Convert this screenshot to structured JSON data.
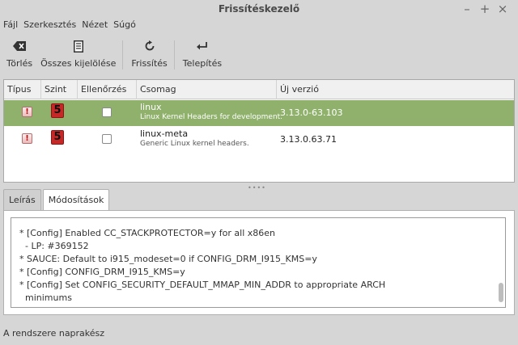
{
  "window": {
    "title": "Frissítéskezelő"
  },
  "menu": [
    "Fájl",
    "Szerkesztés",
    "Nézet",
    "Súgó"
  ],
  "toolbar": {
    "clear_label": "Törlés",
    "select_all_label": "Összes kijelölése",
    "refresh_label": "Frissítés",
    "install_label": "Telepítés"
  },
  "table": {
    "headers": [
      "Típus",
      "Szint",
      "Ellenőrzés",
      "Csomag",
      "Új verzió"
    ],
    "rows": [
      {
        "level": "5",
        "name": "linux",
        "description": "Linux Kernel Headers for development.",
        "version": "3.13.0-63.103",
        "selected": true
      },
      {
        "level": "5",
        "name": "linux-meta",
        "description": "Generic Linux kernel headers.",
        "version": "3.13.0.63.71",
        "selected": false
      }
    ]
  },
  "tabs": [
    "Leírás",
    "Módosítások"
  ],
  "changelog": [
    "* [Config] Enabled CC_STACKPROTECTOR=y for all x86en",
    "  - LP: #369152",
    "* SAUCE: Default to i915_modeset=0 if CONFIG_DRM_I915_KMS=y",
    "* [Config] CONFIG_DRM_I915_KMS=y",
    "* [Config] Set CONFIG_SECURITY_DEFAULT_MMAP_MIN_ADDR to appropriate ARCH",
    "  minimums"
  ],
  "status": "A rendszere naprakész",
  "colors": {
    "selected_row": "#8fb16c",
    "level_badge": "#c62828",
    "warning": "#c01010"
  }
}
